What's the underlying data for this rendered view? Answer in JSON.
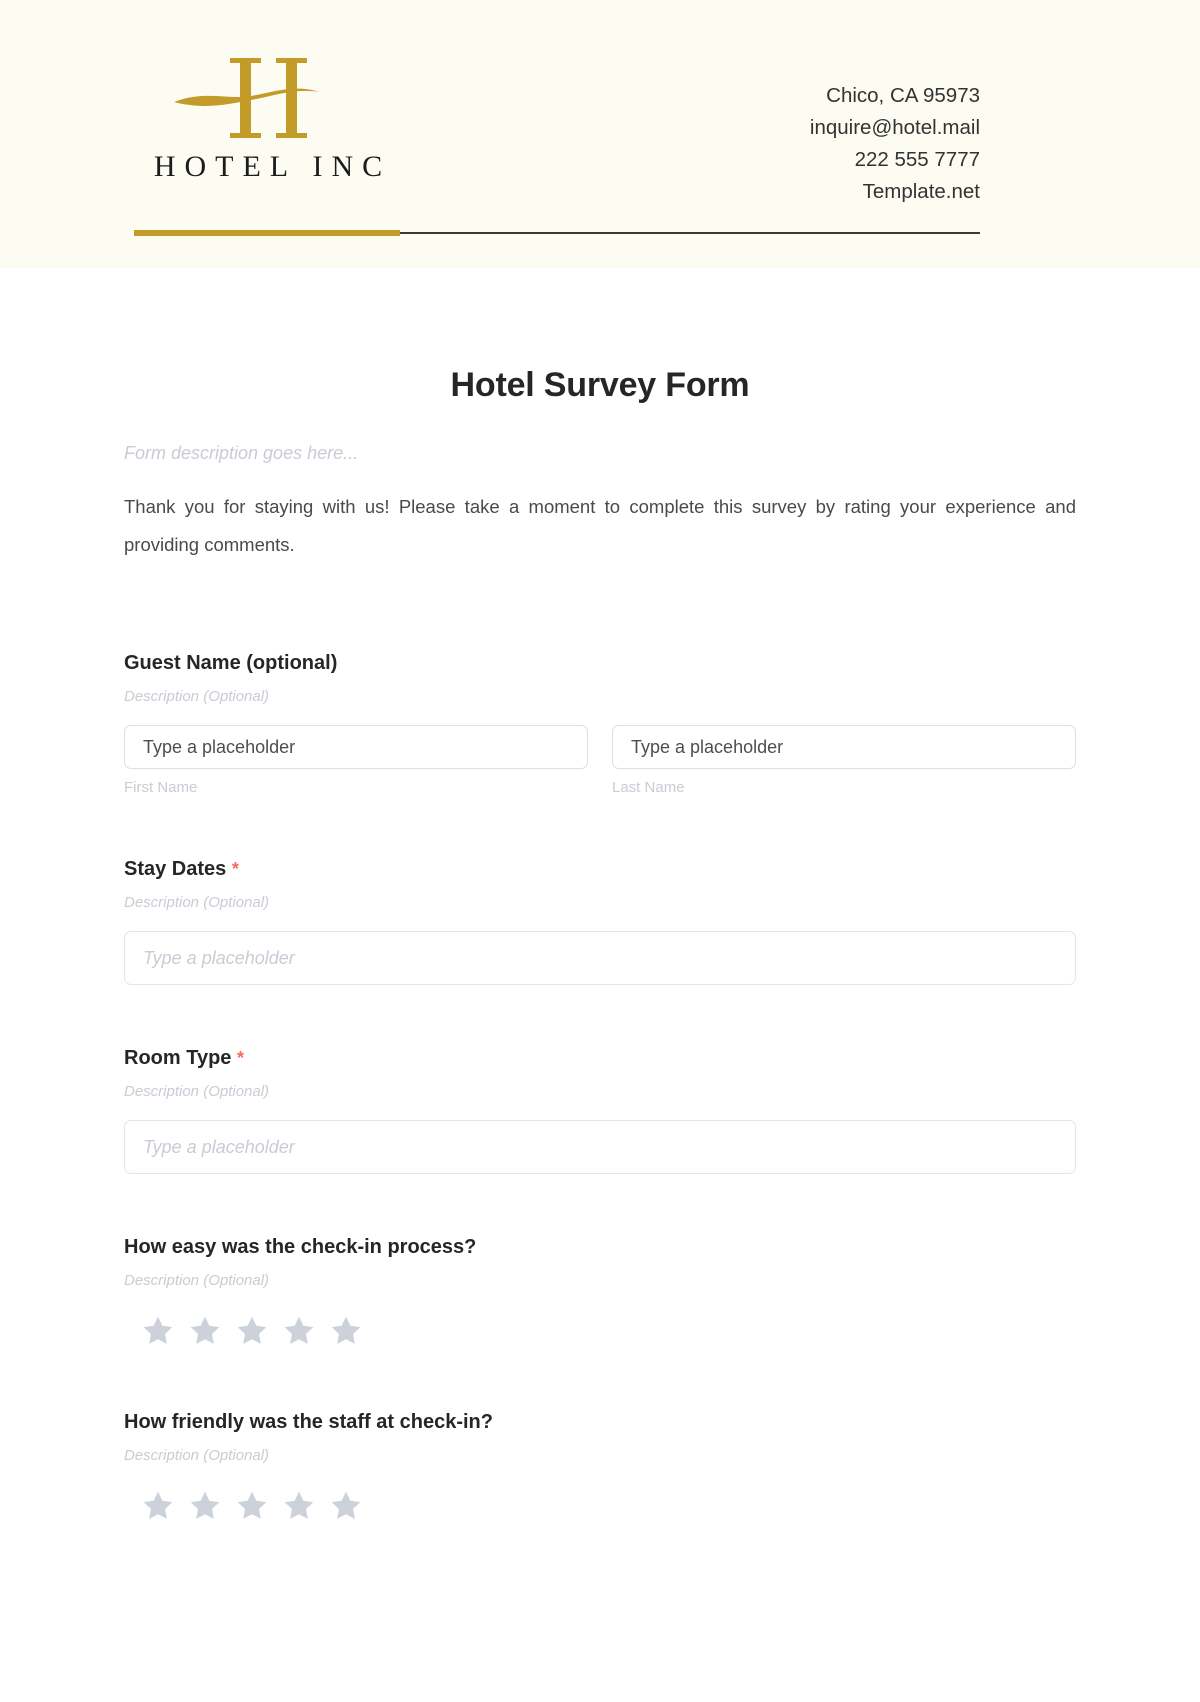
{
  "header": {
    "brand_name": "HOTEL INC",
    "logo_letter": "H",
    "gold": "#c29b28",
    "contact": [
      "Chico, CA 95973",
      "inquire@hotel.mail",
      "222 555 7777",
      "Template.net"
    ]
  },
  "form": {
    "title": "Hotel Survey Form",
    "description": "Form description goes here...",
    "intro": "Thank you for staying with us! Please take a moment to complete this survey by rating your experience and providing comments.",
    "required_marker": "*",
    "fields": [
      {
        "label": "Guest Name (optional)",
        "required": false,
        "description": "Description (Optional)",
        "type": "name-pair",
        "inputs": [
          {
            "placeholder": "Type a placeholder",
            "sub_label": "First Name"
          },
          {
            "placeholder": "Type a placeholder",
            "sub_label": "Last Name"
          }
        ]
      },
      {
        "label": "Stay Dates",
        "required": true,
        "description": "Description (Optional)",
        "type": "text",
        "inputs": [
          {
            "placeholder": "Type a placeholder"
          }
        ]
      },
      {
        "label": "Room Type",
        "required": true,
        "description": "Description (Optional)",
        "type": "text",
        "inputs": [
          {
            "placeholder": "Type a placeholder"
          }
        ]
      },
      {
        "label": "How easy was the check-in process?",
        "required": false,
        "description": "Description (Optional)",
        "type": "rating",
        "star_count": 5,
        "stars_filled": 0,
        "star_color": "#ccd1da"
      },
      {
        "label": "How friendly was the staff at check-in?",
        "required": false,
        "description": "Description (Optional)",
        "type": "rating",
        "star_count": 5,
        "stars_filled": 0,
        "star_color": "#ccd1da"
      }
    ]
  }
}
